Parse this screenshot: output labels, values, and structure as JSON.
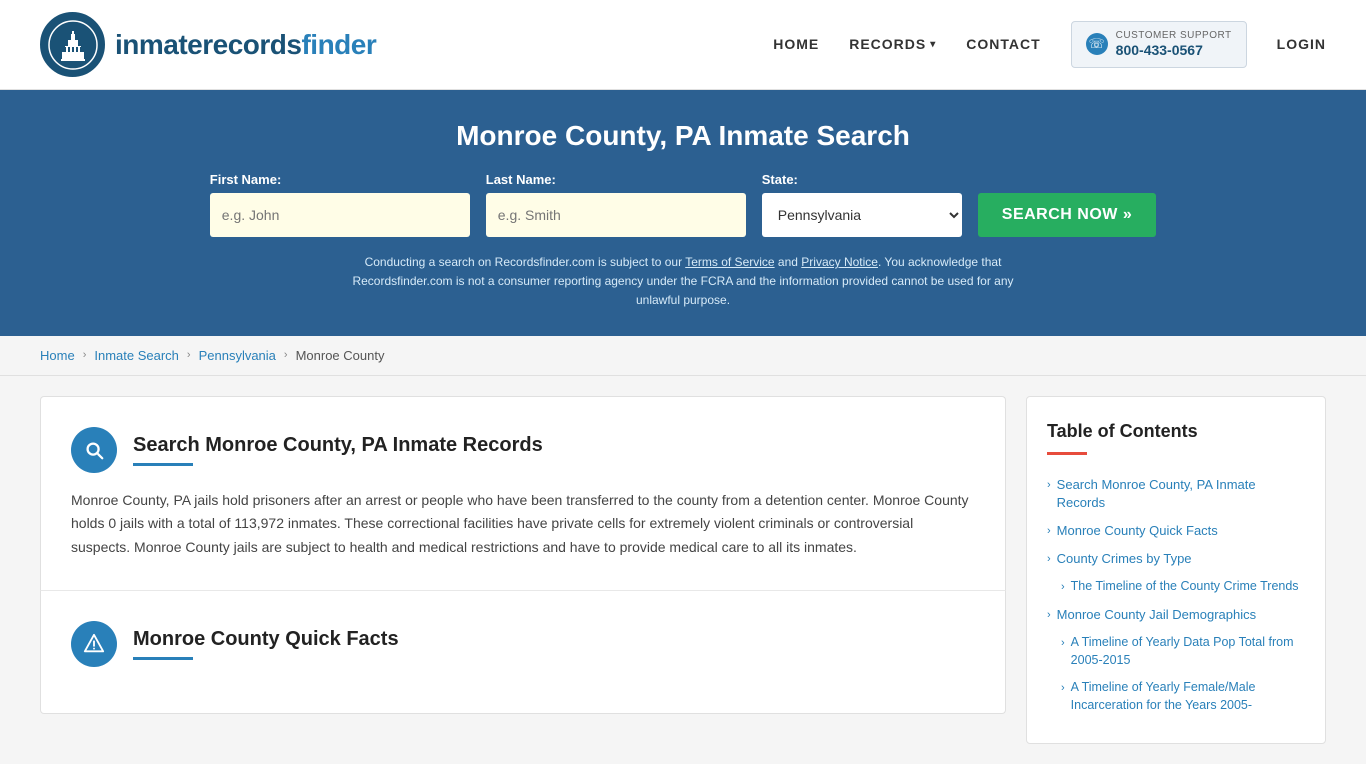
{
  "header": {
    "logo_text_main": "inmaterecords",
    "logo_text_accent": "finder",
    "nav": {
      "home": "HOME",
      "records": "RECORDS",
      "contact": "CONTACT",
      "login": "LOGIN",
      "support_label": "CUSTOMER SUPPORT",
      "support_number": "800-433-0567"
    }
  },
  "hero": {
    "title": "Monroe County, PA Inmate Search",
    "form": {
      "first_name_label": "First Name:",
      "first_name_placeholder": "e.g. John",
      "last_name_label": "Last Name:",
      "last_name_placeholder": "e.g. Smith",
      "state_label": "State:",
      "state_value": "Pennsylvania",
      "search_button": "SEARCH NOW »"
    },
    "disclaimer": "Conducting a search on Recordsfinder.com is subject to our Terms of Service and Privacy Notice. You acknowledge that Recordsfinder.com is not a consumer reporting agency under the FCRA and the information provided cannot be used for any unlawful purpose."
  },
  "breadcrumb": {
    "home": "Home",
    "inmate_search": "Inmate Search",
    "state": "Pennsylvania",
    "county": "Monroe County"
  },
  "main": {
    "section1": {
      "title": "Search Monroe County, PA Inmate Records",
      "body": "Monroe County, PA jails hold prisoners after an arrest or people who have been transferred to the county from a detention center. Monroe County holds 0 jails with a total of 113,972 inmates. These correctional facilities have private cells for extremely violent criminals or controversial suspects. Monroe County jails are subject to health and medical restrictions and have to provide medical care to all its inmates."
    },
    "section2": {
      "title": "Monroe County Quick Facts"
    }
  },
  "toc": {
    "title": "Table of Contents",
    "items": [
      {
        "label": "Search Monroe County, PA Inmate Records",
        "sub": false
      },
      {
        "label": "Monroe County Quick Facts",
        "sub": false
      },
      {
        "label": "County Crimes by Type",
        "sub": false
      },
      {
        "label": "The Timeline of the County Crime Trends",
        "sub": true
      },
      {
        "label": "Monroe County Jail Demographics",
        "sub": false
      },
      {
        "label": "A Timeline of Yearly Data Pop Total from 2005-2015",
        "sub": true
      },
      {
        "label": "A Timeline of Yearly Female/Male Incarceration for the Years 2005-",
        "sub": true
      }
    ]
  }
}
